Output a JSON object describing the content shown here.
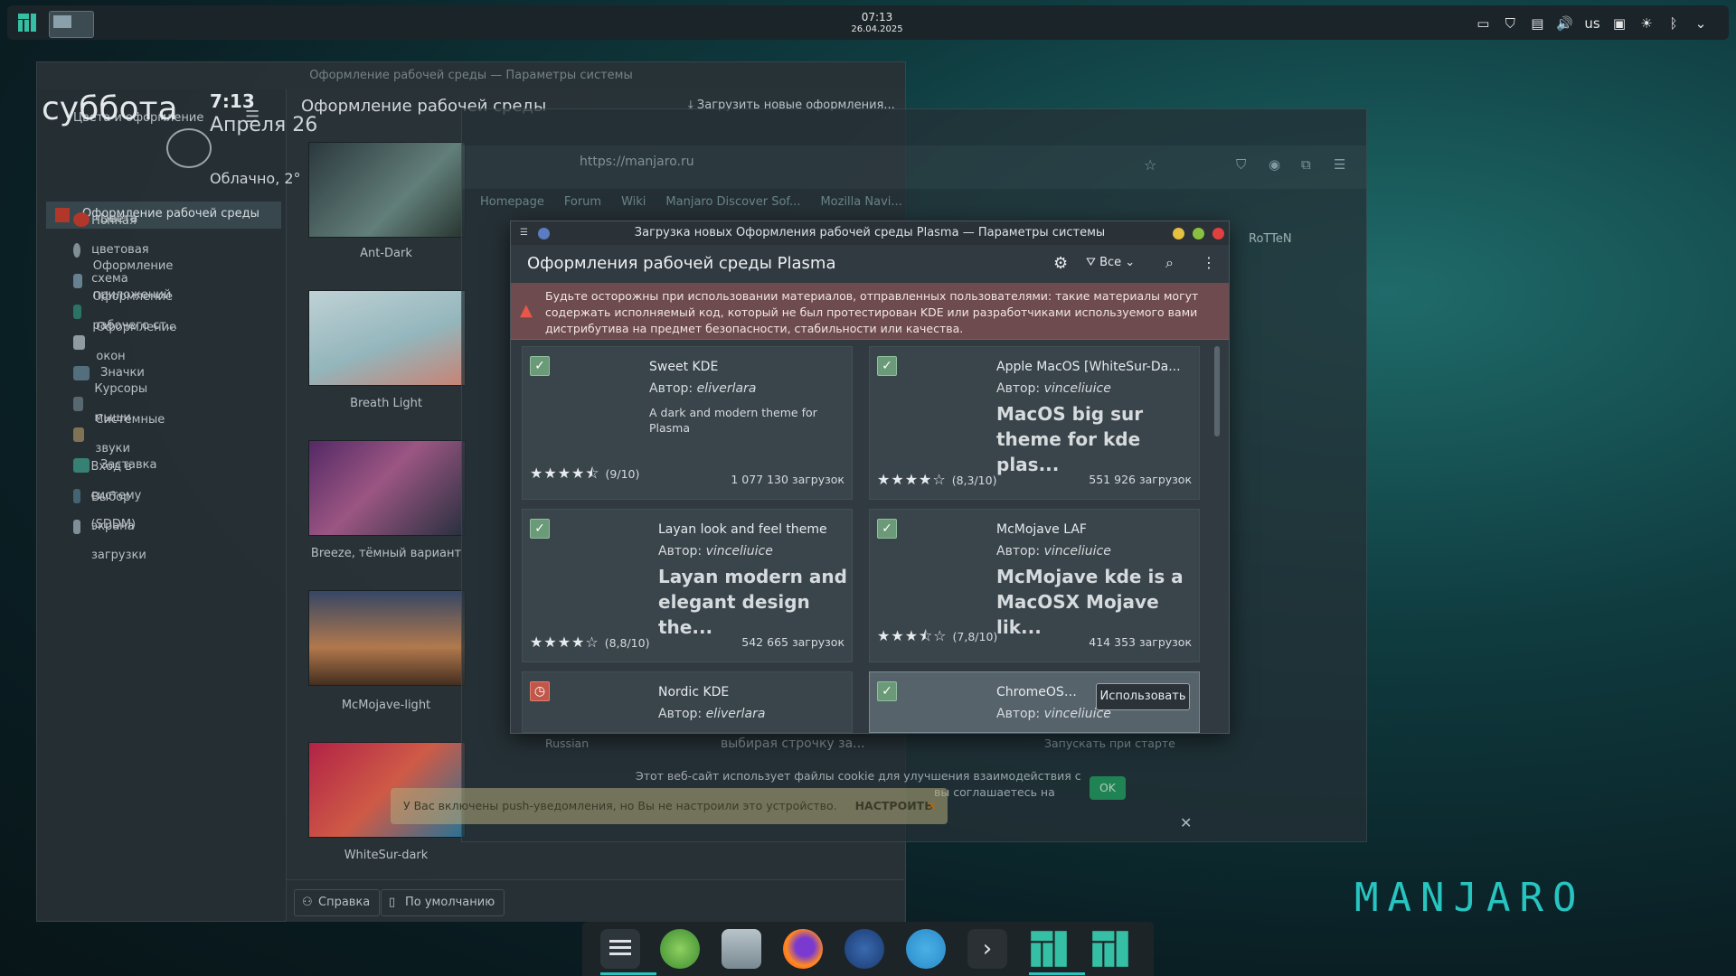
{
  "topbar": {
    "time": "07:13",
    "date": "26.04.2025",
    "keyboard": "us"
  },
  "widget": {
    "day": "суббота",
    "time": "7:13",
    "date": "Апреля 26",
    "weather": "Облачно, 2°"
  },
  "sysset": {
    "title": "Оформление рабочей среды — Параметры системы",
    "back_label": "Цвета и оформление",
    "heading": "Оформление рабочей среды",
    "download": "Загрузить новые оформления...",
    "active_item": "Оформление рабочей среды",
    "sidebar": [
      {
        "label": "Цвета",
        "color": "#c0392b"
      },
      {
        "label": "Ночная цветовая схема",
        "color": "#8a98a0"
      },
      {
        "label": "Оформление приложений",
        "color": "#6f8a9a"
      },
      {
        "label": "Оформление рабочего ст...",
        "color": "#2e7a6a"
      },
      {
        "label": "Оформление окон",
        "color": "#9aa7ad"
      },
      {
        "label": "Значки",
        "color": "#5a7585"
      },
      {
        "label": "Курсоры мыши",
        "color": "#5f6f78"
      },
      {
        "label": "Системные звуки",
        "color": "#8a7a5a"
      },
      {
        "label": "Заставка",
        "color": "#3a8a7a"
      },
      {
        "label": "Вход в систему (SDDM)",
        "color": "#4a6a7a"
      },
      {
        "label": "Выбор экрана загрузки",
        "color": "#8a98a0"
      }
    ],
    "themes": [
      {
        "label": "Ant-Dark"
      },
      {
        "label": "Breath Light"
      },
      {
        "label": "Breeze, тёмный вариант"
      },
      {
        "label": "McMojave-light"
      },
      {
        "label": "WhiteSur-dark"
      }
    ],
    "help": "Справка",
    "defaults": "По умолчанию"
  },
  "browser": {
    "url": "https://manjaro.ru",
    "bookmarks": [
      "Homepage",
      "Forum",
      "Wiki",
      "Manjaro Discover Sof...",
      "Mozilla Navi..."
    ],
    "user": "RoTTeN",
    "cookie_text": "Этот веб-сайт использует файлы cookie для улучшения взаимодействия с",
    "cookie_text2": "вы соглашаетесь на",
    "ok": "OK",
    "startup": "Запускать при старте",
    "lang": "Russian",
    "choose": "выбирая строчку за..."
  },
  "dialog": {
    "title": "Загрузка новых Оформления рабочей среды Plasma — Параметры системы",
    "heading": "Оформления рабочей среды Plasma",
    "filter": "Все",
    "warning": "Будьте осторожны при использовании материалов, отправленных пользователями: такие материалы могут содержать исполняемый код, который не был протестирован KDE или разработчиками используемого вами дистрибутива на предмет безопасности, стабильности или качества.",
    "author_prefix": "Автор:",
    "use_button": "Использовать",
    "cards": [
      {
        "title": "Sweet KDE",
        "author": "eliverlara",
        "desc": "A dark and modern theme for Plasma",
        "big": false,
        "stars": "★★★★⯪",
        "rating": "(9/10)",
        "downloads": "1 077 130 загрузок",
        "checked": true
      },
      {
        "title": "Apple MacOS [WhiteSur-Da...",
        "author": "vinceliuice",
        "desc": "MacOS big sur theme for kde plas...",
        "big": true,
        "stars": "★★★★☆",
        "rating": "(8,3/10)",
        "downloads": "551 926 загрузок",
        "checked": true
      },
      {
        "title": "Layan look and feel theme",
        "author": "vinceliuice",
        "desc": "Layan modern and elegant design the...",
        "big": true,
        "stars": "★★★★☆",
        "rating": "(8,8/10)",
        "downloads": "542 665 загрузок",
        "checked": true
      },
      {
        "title": "McMojave LAF",
        "author": "vinceliuice",
        "desc": "McMojave kde is a MacOSX Mojave lik...",
        "big": true,
        "stars": "★★★⯪☆",
        "rating": "(7,8/10)",
        "downloads": "414 353 загрузок",
        "checked": true
      },
      {
        "title": "Nordic KDE",
        "author": "eliverlara",
        "desc": "",
        "big": false,
        "stars": "",
        "rating": "",
        "downloads": "",
        "checked": false
      },
      {
        "title": "ChromeOS Gl...",
        "author": "vinceliuice",
        "desc": "",
        "big": false,
        "stars": "",
        "rating": "",
        "downloads": "",
        "checked": true
      }
    ]
  },
  "notification": {
    "text": "У Вас включены push-уведомления, но Вы не настроили это устройство.",
    "action": "НАСТРОИТЬ"
  },
  "brand": "MANJARO",
  "colors": {
    "accent": "#27c4c0",
    "warning_bg": "#6e4b4e"
  }
}
